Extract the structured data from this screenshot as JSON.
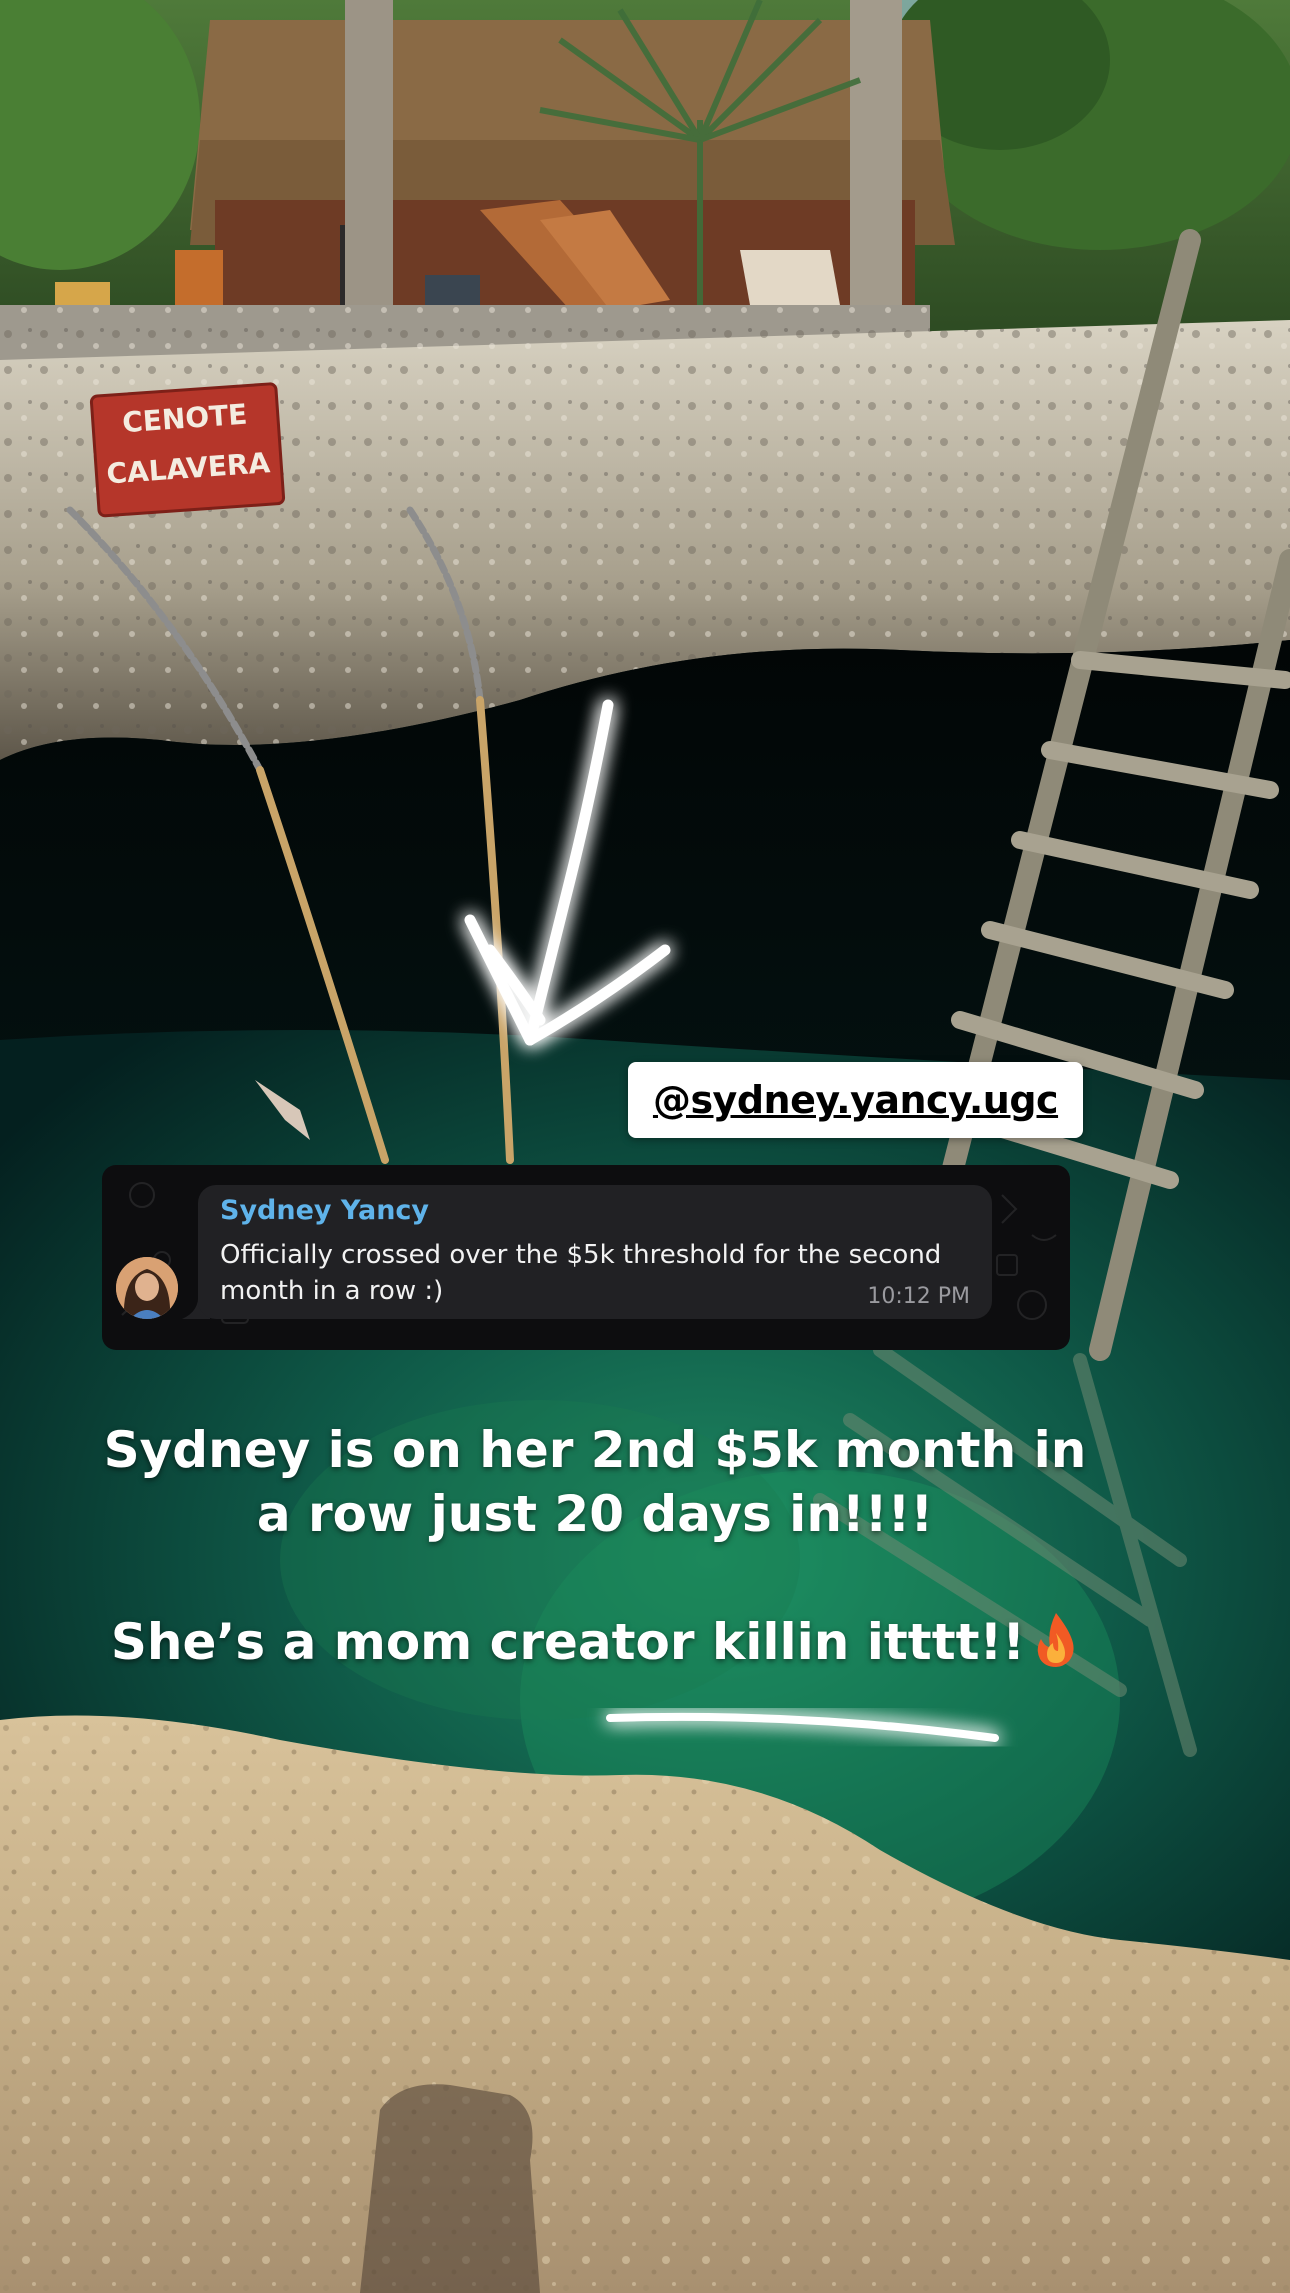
{
  "story": {
    "sign": {
      "line1": "CENOTE",
      "line2": "CALAVERA"
    },
    "mention": "@sydney.yancy.ugc",
    "chat": {
      "sender": "Sydney Yancy",
      "message": "Officially crossed over the $5k threshold for the second month in a row :)",
      "time": "10:12 PM"
    },
    "caption": {
      "line1": "Sydney is on her 2nd $5k month in a row just 20 days in!!!!",
      "line2": "She’s a mom creator killin itttt!!"
    },
    "colors": {
      "sender_name": "#5fb3ea",
      "bubble": "#212124",
      "card": "#0d0d0f",
      "water": "#0f5a4a",
      "rock": "#c9b48e",
      "sign": "#b5362a"
    },
    "icons": [
      "arrow-doodle",
      "underline-doodle",
      "fire-emoji",
      "avatar"
    ]
  }
}
